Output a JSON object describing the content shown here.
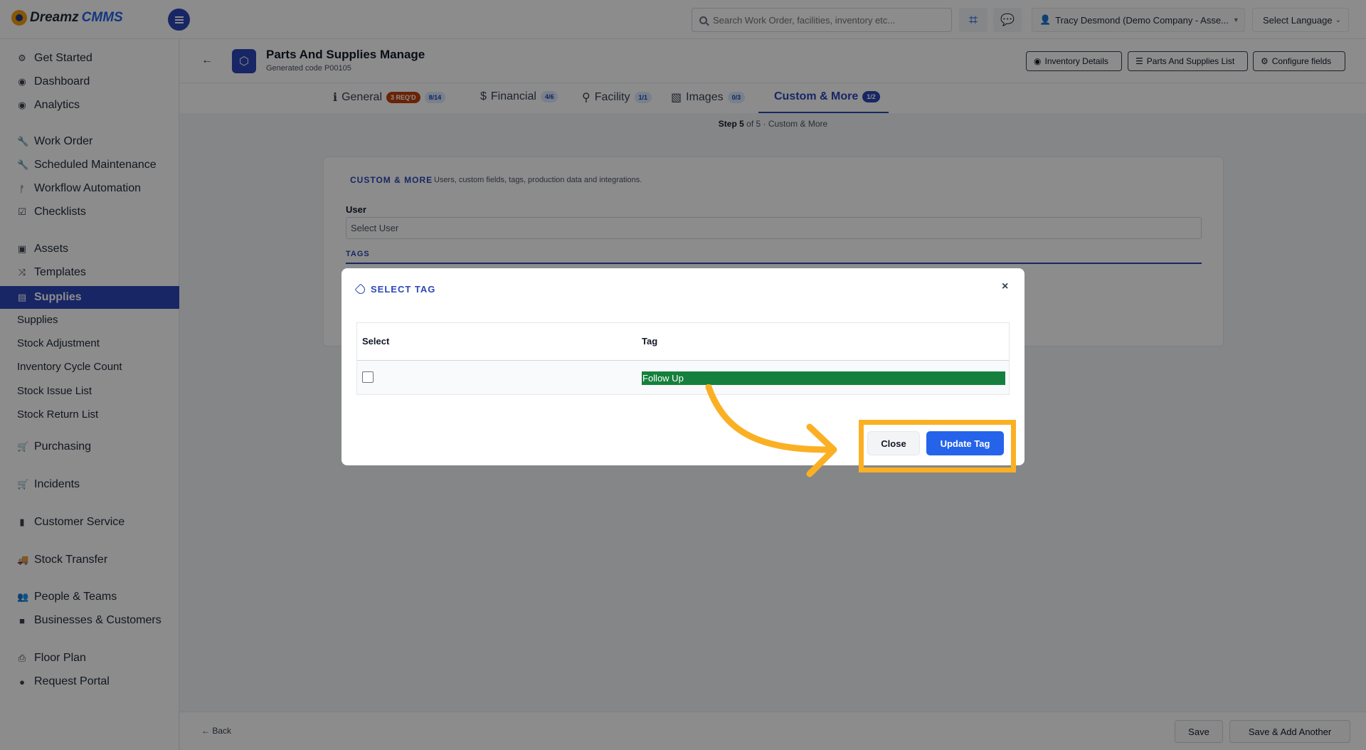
{
  "app": {
    "logo_word1": "Dreamz",
    "logo_word2": "CMMS"
  },
  "topbar": {
    "search_placeholder": "Search Work Order, facilities, inventory etc...",
    "user_name": "Tracy Desmond (Demo Company - Asse...",
    "language_label": "Select Language"
  },
  "sidebar": {
    "items": [
      {
        "label": "Get Started",
        "icon": "rocket-icon"
      },
      {
        "label": "Dashboard",
        "icon": "dashboard-icon"
      },
      {
        "label": "Analytics",
        "icon": "analytics-icon"
      },
      {
        "label": "Work Order",
        "icon": "wrench-icon"
      },
      {
        "label": "Scheduled Maintenance",
        "icon": "wrench-icon"
      },
      {
        "label": "Workflow Automation",
        "icon": "workflow-icon"
      },
      {
        "label": "Checklists",
        "icon": "checklist-icon"
      },
      {
        "label": "Assets",
        "icon": "assets-icon"
      },
      {
        "label": "Templates",
        "icon": "templates-icon"
      },
      {
        "label": "Supplies",
        "icon": "supplies-icon"
      },
      {
        "label": "Purchasing",
        "icon": "cart-icon"
      },
      {
        "label": "Incidents",
        "icon": "cart-icon"
      },
      {
        "label": "Customer Service",
        "icon": "document-icon"
      },
      {
        "label": "Stock Transfer",
        "icon": "truck-icon"
      },
      {
        "label": "People & Teams",
        "icon": "people-icon"
      },
      {
        "label": "Businesses & Customers",
        "icon": "video-icon"
      },
      {
        "label": "Floor Plan",
        "icon": "printer-icon"
      },
      {
        "label": "Request Portal",
        "icon": "comment-icon"
      }
    ],
    "sub_items": [
      "Supplies",
      "Stock Adjustment",
      "Inventory Cycle Count",
      "Stock Issue List",
      "Stock Return List"
    ]
  },
  "page": {
    "title": "Parts And Supplies Manage",
    "subtitle": "Generated code P00105",
    "buttons": {
      "inventory_details": "Inventory Details",
      "supplies_list": "Parts And Supplies List",
      "configure_fields": "Configure fields"
    }
  },
  "tabs": [
    {
      "label": "General",
      "badge_req": "3 REQ'D",
      "badge": "8/14"
    },
    {
      "label": "Financial",
      "badge": "4/6"
    },
    {
      "label": "Facility",
      "badge": "1/1"
    },
    {
      "label": "Images",
      "badge": "0/3"
    },
    {
      "label": "Custom & More",
      "badge": "1/2"
    }
  ],
  "step": {
    "prefix": "Step 5",
    "suffix": "of 5 · Custom & More"
  },
  "section": {
    "title": "CUSTOM & MORE",
    "description": "Users, custom fields, tags, production data and integrations.",
    "user_label": "User",
    "user_placeholder": "Select User",
    "tags_label": "TAGS"
  },
  "bottom": {
    "back": "← Back",
    "save": "Save",
    "save_add": "Save & Add Another"
  },
  "modal": {
    "title": "SELECT TAG",
    "close_symbol": "×",
    "col_select": "Select",
    "col_tag": "Tag",
    "rows": [
      {
        "tag": "Follow Up",
        "checked": false
      }
    ],
    "close_button": "Close",
    "update_button": "Update Tag"
  },
  "colors": {
    "primary": "#2d46b9",
    "accent_blue": "#2563eb",
    "tag_green": "#15803d",
    "highlight": "#fbb024",
    "required_badge": "#c2410c"
  }
}
